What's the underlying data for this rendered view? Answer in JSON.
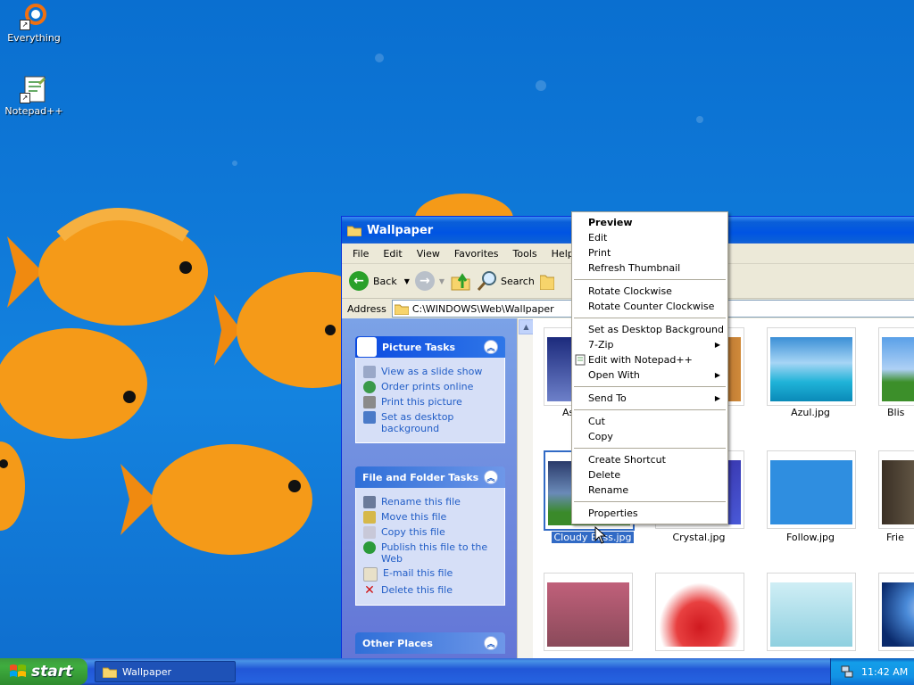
{
  "desktop": {
    "icons": [
      {
        "label": "Everything",
        "icon": "everything-icon"
      },
      {
        "label": "Notepad++",
        "icon": "notepadpp-icon"
      }
    ]
  },
  "window": {
    "title": "Wallpaper",
    "menu": [
      "File",
      "Edit",
      "View",
      "Favorites",
      "Tools",
      "Help"
    ],
    "toolbar": {
      "back_label": "Back",
      "search_label": "Search"
    },
    "address": {
      "label": "Address",
      "value": "C:\\WINDOWS\\Web\\Wallpaper"
    },
    "picture_tasks": {
      "title": "Picture Tasks",
      "items": [
        "View as a slide show",
        "Order prints online",
        "Print this picture",
        "Set as desktop background"
      ]
    },
    "file_tasks": {
      "title": "File and Folder Tasks",
      "items": [
        "Rename this file",
        "Move this file",
        "Copy this file",
        "Publish this file to the Web",
        "E-mail this file",
        "Delete this file"
      ]
    },
    "other_places": {
      "title": "Other Places"
    },
    "files": [
      {
        "name": "As",
        "colors": [
          "#2a3a8c",
          "#6d80c9"
        ]
      },
      {
        "name": "",
        "colors": [
          "#8a3a10",
          "#d08a3a"
        ]
      },
      {
        "name": "Azul.jpg",
        "colors": [
          "#3b8fd6",
          "#1fb3d8"
        ]
      },
      {
        "name": "Blis",
        "colors": [
          "#5aa0e8",
          "#3c8f2a"
        ]
      },
      {
        "name": "Cloudy Bliss.jpg",
        "colors": [
          "#4b6aa8",
          "#3a8a2a"
        ]
      },
      {
        "name": "Crystal.jpg",
        "colors": [
          "#2a1a8c",
          "#4a5ad8"
        ]
      },
      {
        "name": "Follow.jpg",
        "colors": [
          "#2f8ee0",
          "#1c6fc8"
        ]
      },
      {
        "name": "Frie",
        "colors": [
          "#3a3025",
          "#9a8a70"
        ]
      },
      {
        "name": "",
        "colors": [
          "#c0607a",
          "#8a4a5a"
        ]
      },
      {
        "name": "",
        "colors": [
          "#ffffff",
          "#d01a20"
        ]
      },
      {
        "name": "",
        "colors": [
          "#cfeef5",
          "#8fd0e0"
        ]
      },
      {
        "name": "",
        "colors": [
          "#0a2a6c",
          "#4a8ad8"
        ]
      }
    ]
  },
  "context_menu": {
    "items": [
      {
        "label": "Preview",
        "bold": true
      },
      {
        "label": "Edit"
      },
      {
        "label": "Print"
      },
      {
        "label": "Refresh Thumbnail"
      },
      {
        "sep": true
      },
      {
        "label": "Rotate Clockwise"
      },
      {
        "label": "Rotate Counter Clockwise"
      },
      {
        "sep": true
      },
      {
        "label": "Set as Desktop Background"
      },
      {
        "label": "7-Zip",
        "submenu": true
      },
      {
        "label": "Edit with Notepad++",
        "icon": true
      },
      {
        "label": "Open With",
        "submenu": true
      },
      {
        "sep": true
      },
      {
        "label": "Send To",
        "submenu": true
      },
      {
        "sep": true
      },
      {
        "label": "Cut"
      },
      {
        "label": "Copy"
      },
      {
        "sep": true
      },
      {
        "label": "Create Shortcut"
      },
      {
        "label": "Delete"
      },
      {
        "label": "Rename"
      },
      {
        "sep": true
      },
      {
        "label": "Properties"
      }
    ]
  },
  "taskbar": {
    "start_label": "start",
    "task_label": "Wallpaper",
    "clock": "11:42 AM"
  }
}
